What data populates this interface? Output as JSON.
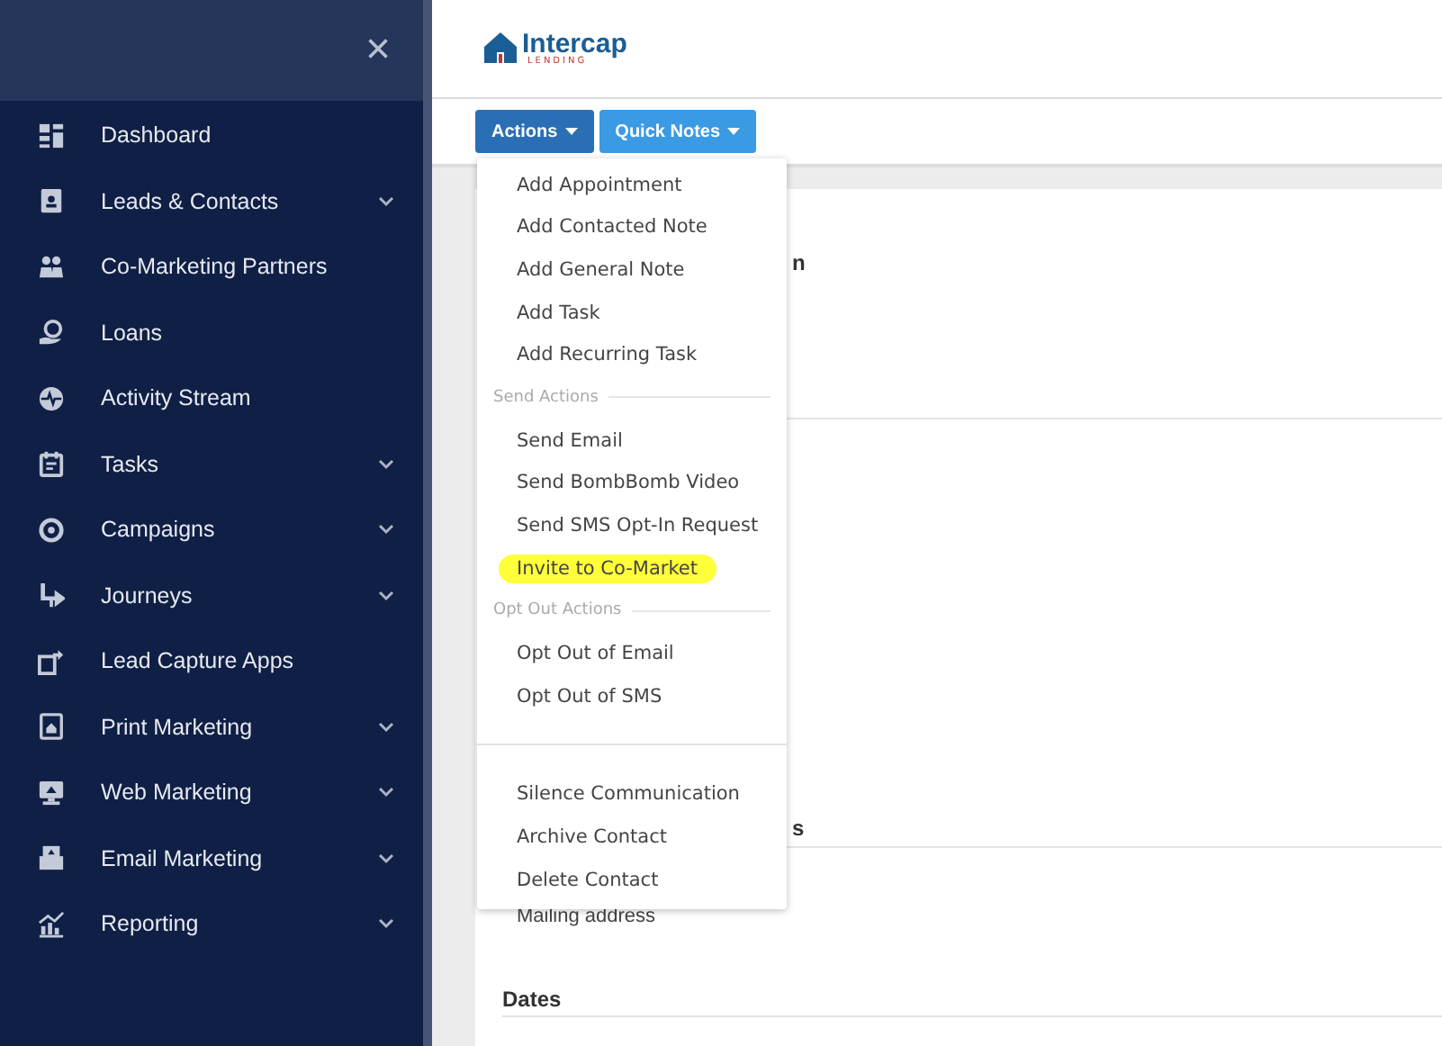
{
  "sidebar": {
    "close_icon": "×",
    "items": [
      {
        "label": "Dashboard",
        "expandable": false
      },
      {
        "label": "Leads & Contacts",
        "expandable": true
      },
      {
        "label": "Co-Marketing Partners",
        "expandable": false
      },
      {
        "label": "Loans",
        "expandable": false
      },
      {
        "label": "Activity Stream",
        "expandable": false
      },
      {
        "label": "Tasks",
        "expandable": true
      },
      {
        "label": "Campaigns",
        "expandable": true
      },
      {
        "label": "Journeys",
        "expandable": true
      },
      {
        "label": "Lead Capture Apps",
        "expandable": false
      },
      {
        "label": "Print Marketing",
        "expandable": true
      },
      {
        "label": "Web Marketing",
        "expandable": true
      },
      {
        "label": "Email Marketing",
        "expandable": true
      },
      {
        "label": "Reporting",
        "expandable": true
      }
    ]
  },
  "header": {
    "logo": {
      "name": "Intercap",
      "tagline": "LENDING"
    }
  },
  "toolbar": {
    "buttons": [
      {
        "label": "Actions",
        "selected": true
      },
      {
        "label": "Quick Notes",
        "selected": false
      }
    ]
  },
  "actions_menu": {
    "items": [
      {
        "kind": "item",
        "label": "Add Appointment",
        "highlighted": false
      },
      {
        "kind": "item",
        "label": "Add Contacted Note",
        "highlighted": false
      },
      {
        "kind": "item",
        "label": "Add General Note",
        "highlighted": false
      },
      {
        "kind": "item",
        "label": "Add Task",
        "highlighted": false
      },
      {
        "kind": "item",
        "label": "Add Recurring Task",
        "highlighted": false
      },
      {
        "kind": "header",
        "label": "Send Actions"
      },
      {
        "kind": "item",
        "label": "Send Email",
        "highlighted": false
      },
      {
        "kind": "item",
        "label": "Send BombBomb Video",
        "highlighted": false
      },
      {
        "kind": "item",
        "label": "Send SMS Opt-In Request",
        "highlighted": false
      },
      {
        "kind": "item",
        "label": "Invite to Co-Market",
        "highlighted": true
      },
      {
        "kind": "header",
        "label": "Opt Out Actions"
      },
      {
        "kind": "item",
        "label": "Opt Out of Email",
        "highlighted": false
      },
      {
        "kind": "item",
        "label": "Opt Out of SMS",
        "highlighted": false
      },
      {
        "kind": "divider"
      },
      {
        "kind": "item",
        "label": "Silence Communication",
        "highlighted": false
      },
      {
        "kind": "item",
        "label": "Archive Contact",
        "highlighted": false
      },
      {
        "kind": "item",
        "label": "Delete Contact",
        "highlighted": false
      }
    ]
  },
  "content": {
    "sections": [
      {
        "heading": "n"
      },
      {
        "heading": "s",
        "rows": [
          "Mailing address"
        ]
      },
      {
        "heading": "Dates"
      }
    ]
  }
}
